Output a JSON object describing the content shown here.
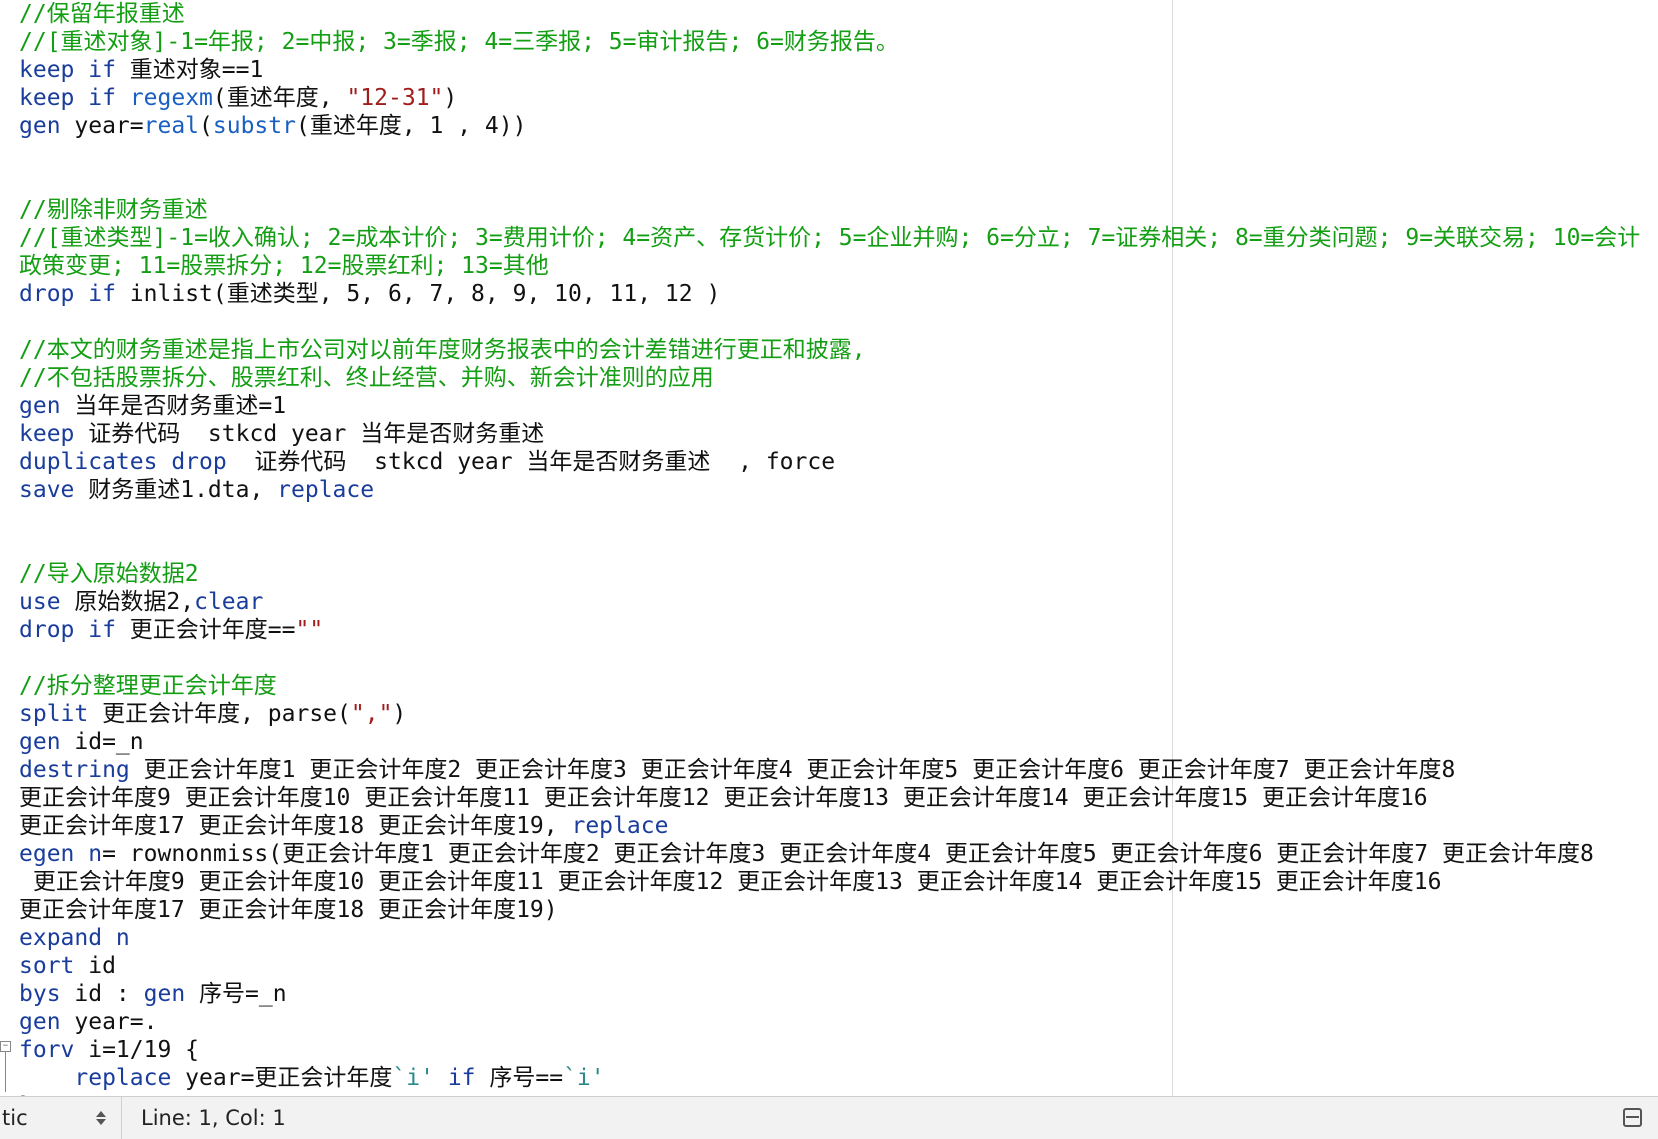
{
  "editor": {
    "lines": [
      [
        {
          "t": "cm",
          "v": "//保留年报重述"
        }
      ],
      [
        {
          "t": "cm",
          "v": "//[重述对象]-1=年报; 2=中报; 3=季报; 4=三季报; 5=审计报告; 6=财务报告。"
        }
      ],
      [
        {
          "t": "kw",
          "v": "keep"
        },
        {
          "t": "pl",
          "v": " "
        },
        {
          "t": "kw",
          "v": "if"
        },
        {
          "t": "pl",
          "v": " 重述对象==1"
        }
      ],
      [
        {
          "t": "kw",
          "v": "keep"
        },
        {
          "t": "pl",
          "v": " "
        },
        {
          "t": "kw",
          "v": "if"
        },
        {
          "t": "pl",
          "v": " "
        },
        {
          "t": "fn",
          "v": "regexm"
        },
        {
          "t": "pl",
          "v": "(重述年度, "
        },
        {
          "t": "str",
          "v": "\"12-31\""
        },
        {
          "t": "pl",
          "v": ")"
        }
      ],
      [
        {
          "t": "kw",
          "v": "gen"
        },
        {
          "t": "pl",
          "v": " year="
        },
        {
          "t": "fn",
          "v": "real"
        },
        {
          "t": "pl",
          "v": "("
        },
        {
          "t": "fn",
          "v": "substr"
        },
        {
          "t": "pl",
          "v": "(重述年度, 1 , 4))"
        }
      ],
      [],
      [],
      [
        {
          "t": "cm",
          "v": "//剔除非财务重述"
        }
      ],
      [
        {
          "t": "cm",
          "v": "//[重述类型]-1=收入确认; 2=成本计价; 3=费用计价; 4=资产、存货计价; 5=企业并购; 6=分立; 7=证券相关; 8=重分类问题; 9=关联交易; 10=会计"
        }
      ],
      [
        {
          "t": "cm",
          "v": "政策变更; 11=股票拆分; 12=股票红利; 13=其他"
        }
      ],
      [
        {
          "t": "kw",
          "v": "drop"
        },
        {
          "t": "pl",
          "v": " "
        },
        {
          "t": "kw",
          "v": "if"
        },
        {
          "t": "pl",
          "v": " inlist(重述类型, 5, 6, 7, 8, 9, 10, 11, 12 )"
        }
      ],
      [],
      [
        {
          "t": "cm",
          "v": "//本文的财务重述是指上市公司对以前年度财务报表中的会计差错进行更正和披露,"
        }
      ],
      [
        {
          "t": "cm",
          "v": "//不包括股票拆分、股票红利、终止经营、并购、新会计准则的应用"
        }
      ],
      [
        {
          "t": "kw",
          "v": "gen"
        },
        {
          "t": "pl",
          "v": " 当年是否财务重述=1"
        }
      ],
      [
        {
          "t": "kw",
          "v": "keep"
        },
        {
          "t": "pl",
          "v": " 证券代码  stkcd year 当年是否财务重述"
        }
      ],
      [
        {
          "t": "kw",
          "v": "duplicates drop"
        },
        {
          "t": "pl",
          "v": "  证券代码  stkcd year 当年是否财务重述  , force"
        }
      ],
      [
        {
          "t": "kw",
          "v": "save"
        },
        {
          "t": "pl",
          "v": " 财务重述1.dta, "
        },
        {
          "t": "kw",
          "v": "replace"
        }
      ],
      [],
      [],
      [
        {
          "t": "cm",
          "v": "//导入原始数据2"
        }
      ],
      [
        {
          "t": "kw",
          "v": "use"
        },
        {
          "t": "pl",
          "v": " 原始数据2,"
        },
        {
          "t": "kw",
          "v": "clear"
        }
      ],
      [
        {
          "t": "kw",
          "v": "drop"
        },
        {
          "t": "pl",
          "v": " "
        },
        {
          "t": "kw",
          "v": "if"
        },
        {
          "t": "pl",
          "v": " 更正会计年度=="
        },
        {
          "t": "str",
          "v": "\"\""
        }
      ],
      [],
      [
        {
          "t": "cm",
          "v": "//拆分整理更正会计年度"
        }
      ],
      [
        {
          "t": "kw",
          "v": "split"
        },
        {
          "t": "pl",
          "v": " 更正会计年度, parse("
        },
        {
          "t": "str",
          "v": "\",\""
        },
        {
          "t": "pl",
          "v": ")"
        }
      ],
      [
        {
          "t": "kw",
          "v": "gen"
        },
        {
          "t": "pl",
          "v": " id=_n"
        }
      ],
      [
        {
          "t": "kw",
          "v": "destring"
        },
        {
          "t": "pl",
          "v": " 更正会计年度1 更正会计年度2 更正会计年度3 更正会计年度4 更正会计年度5 更正会计年度6 更正会计年度7 更正会计年度8"
        }
      ],
      [
        {
          "t": "pl",
          "v": "更正会计年度9 更正会计年度10 更正会计年度11 更正会计年度12 更正会计年度13 更正会计年度14 更正会计年度15 更正会计年度16"
        }
      ],
      [
        {
          "t": "pl",
          "v": "更正会计年度17 更正会计年度18 更正会计年度19, "
        },
        {
          "t": "kw",
          "v": "replace"
        }
      ],
      [
        {
          "t": "kw",
          "v": "egen"
        },
        {
          "t": "pl",
          "v": " "
        },
        {
          "t": "kw",
          "v": "n"
        },
        {
          "t": "pl",
          "v": "= rownonmiss(更正会计年度1 更正会计年度2 更正会计年度3 更正会计年度4 更正会计年度5 更正会计年度6 更正会计年度7 更正会计年度8"
        }
      ],
      [
        {
          "t": "pl",
          "v": " 更正会计年度9 更正会计年度10 更正会计年度11 更正会计年度12 更正会计年度13 更正会计年度14 更正会计年度15 更正会计年度16"
        }
      ],
      [
        {
          "t": "pl",
          "v": "更正会计年度17 更正会计年度18 更正会计年度19)"
        }
      ],
      [
        {
          "t": "kw",
          "v": "expand n"
        }
      ],
      [
        {
          "t": "kw",
          "v": "sort"
        },
        {
          "t": "pl",
          "v": " id"
        }
      ],
      [
        {
          "t": "kw",
          "v": "bys"
        },
        {
          "t": "pl",
          "v": " id : "
        },
        {
          "t": "kw",
          "v": "gen"
        },
        {
          "t": "pl",
          "v": " 序号=_n"
        }
      ],
      [
        {
          "t": "kw",
          "v": "gen"
        },
        {
          "t": "pl",
          "v": " year=."
        }
      ],
      [
        {
          "t": "kw",
          "v": "forv"
        },
        {
          "t": "pl",
          "v": " i=1/19 {"
        }
      ],
      [
        {
          "t": "pl",
          "v": "    "
        },
        {
          "t": "kw",
          "v": "replace"
        },
        {
          "t": "pl",
          "v": " year=更正会计年度"
        },
        {
          "t": "local",
          "v": "`i'"
        },
        {
          "t": "pl",
          "v": " "
        },
        {
          "t": "kw",
          "v": "if"
        },
        {
          "t": "pl",
          "v": " 序号=="
        },
        {
          "t": "local",
          "v": "`i'"
        }
      ],
      [
        {
          "t": "pl",
          "v": "}"
        }
      ]
    ]
  },
  "statusbar": {
    "language": "tic",
    "position": "Line: 1, Col: 1"
  },
  "icons": {
    "language_chevron": "updown-chevron-icon",
    "split": "split-view-icon",
    "fold": "fold-toggle-icon"
  },
  "colors": {
    "keyword": "#1a3d9c",
    "function": "#1a5fc2",
    "string": "#a11d1d",
    "comment": "#139e13",
    "plain": "#111111",
    "local_macro": "#2a8a8a"
  }
}
